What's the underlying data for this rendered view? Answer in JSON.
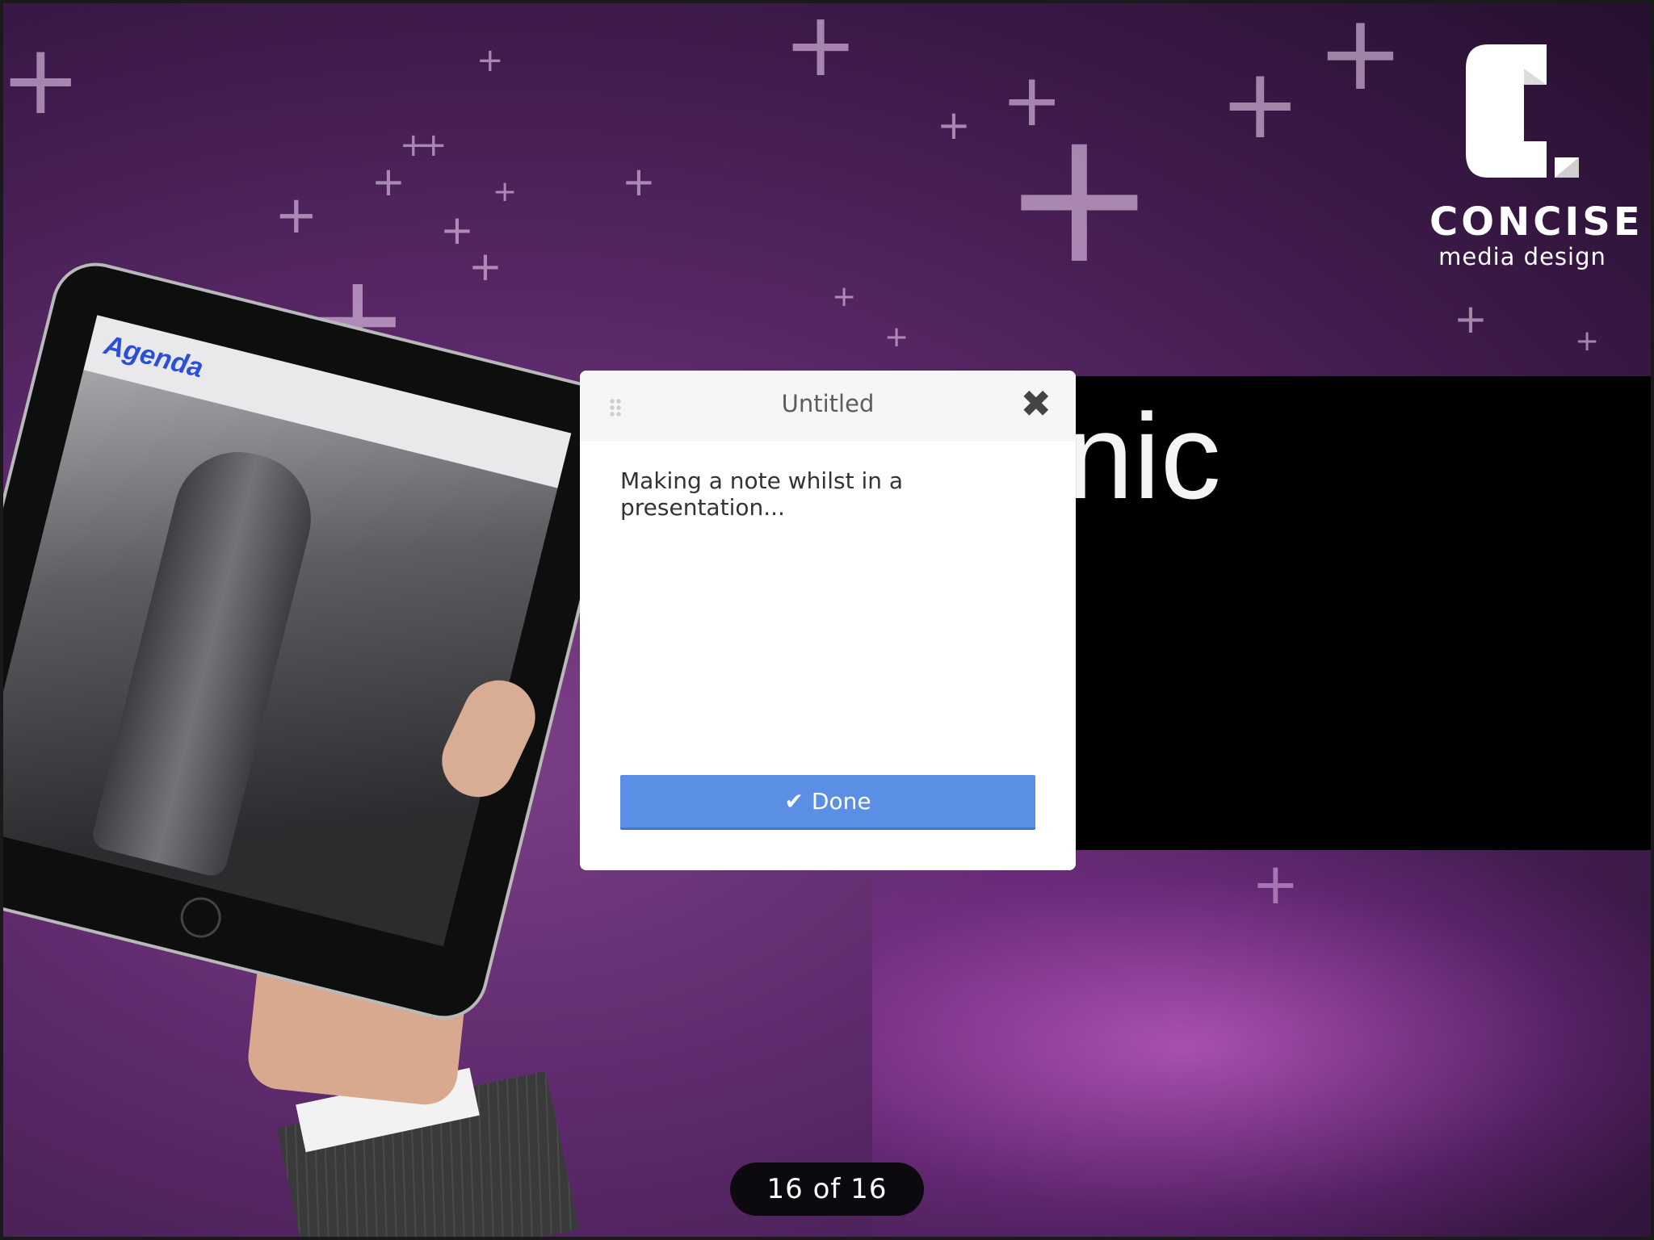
{
  "slide": {
    "title_fragment": "nic",
    "logo": {
      "name": "CONCISE",
      "subtitle": "media design"
    },
    "tablet_screen_title": "Agenda",
    "counter": "16 of 16"
  },
  "note_dialog": {
    "title": "Untitled",
    "text": "Making a note whilst in a presentation...",
    "done_label": "Done",
    "icons": {
      "drag": "drag-handle-icon",
      "close": "close-icon",
      "done": "checkmark-icon"
    },
    "accent_color": "#5b8fe6"
  },
  "colors": {
    "background": "#5e2a6c",
    "panel": "#000000"
  }
}
